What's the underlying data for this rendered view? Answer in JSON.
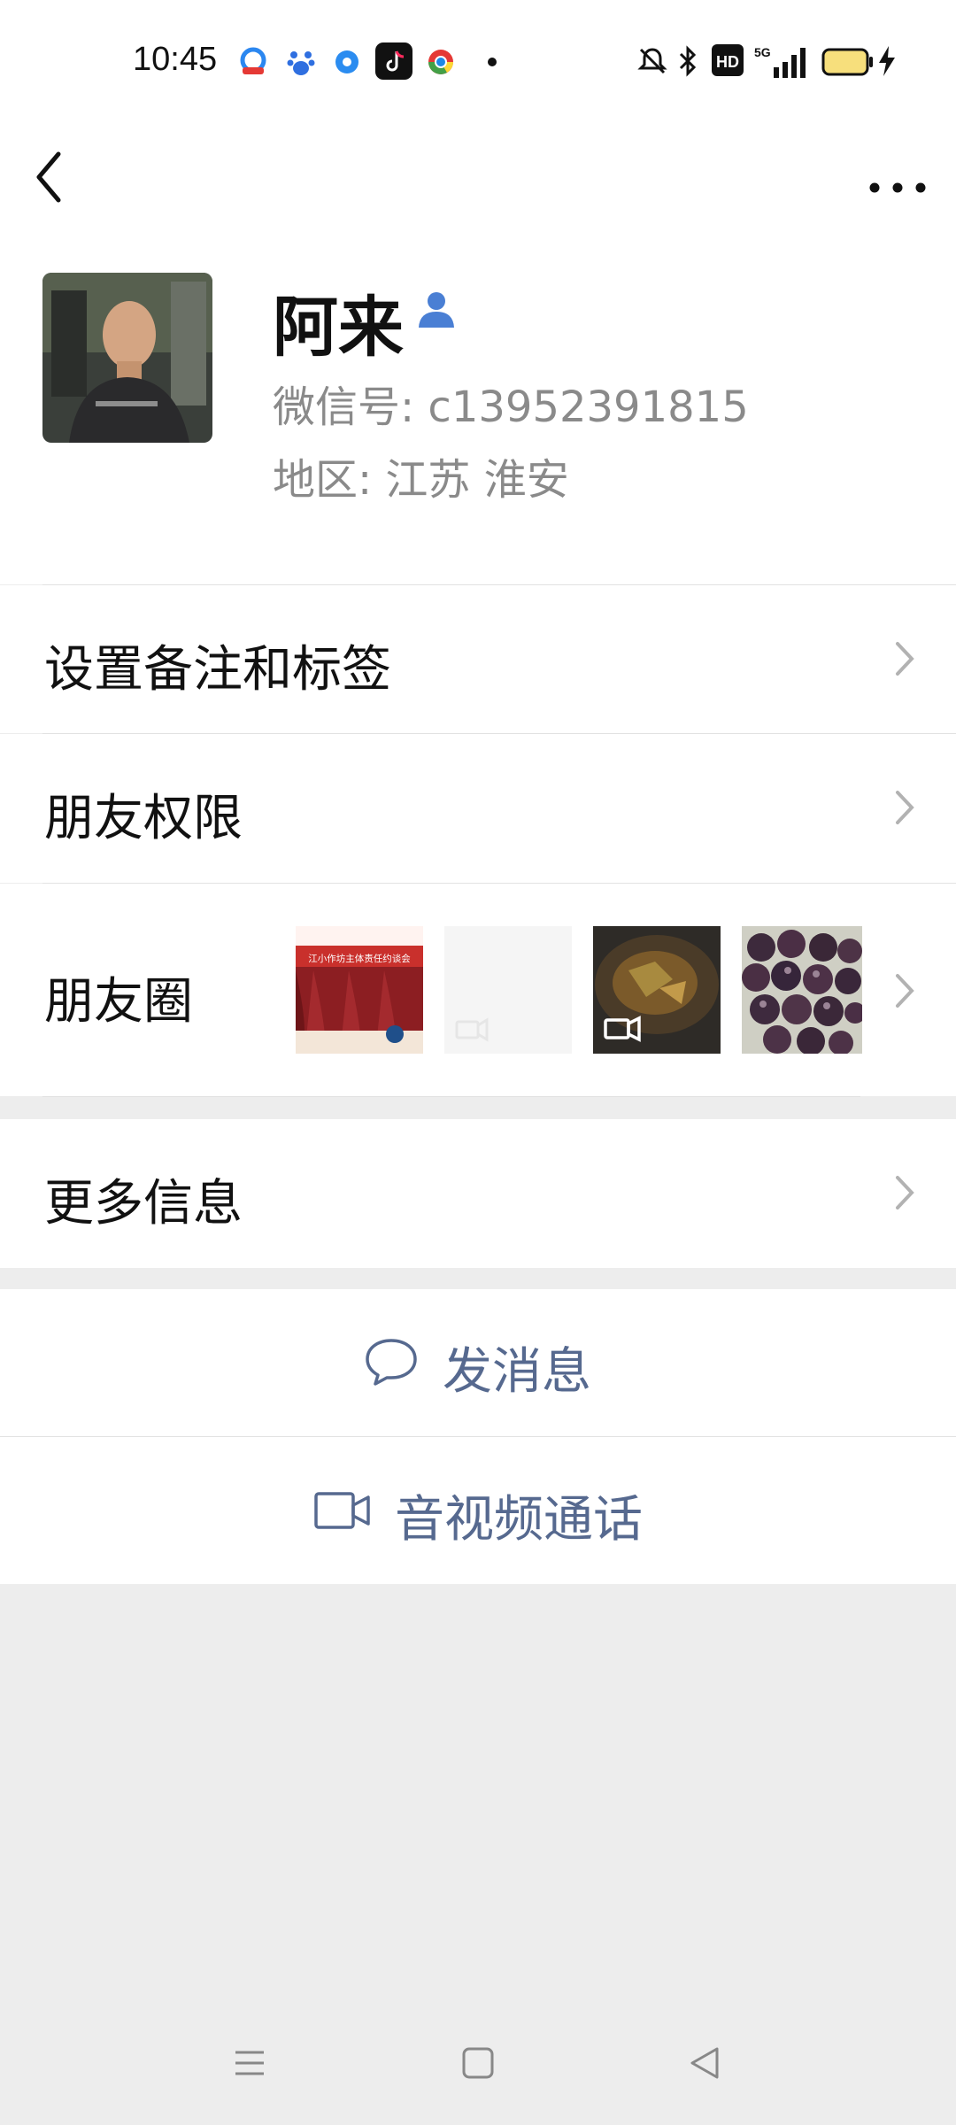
{
  "status_bar": {
    "time": "10:45",
    "app_icons": [
      "qq-browser-icon",
      "baidu-icon",
      "blue-dot-icon",
      "tiktok-icon",
      "chrome-icon",
      "dot-icon"
    ],
    "right_icons": [
      "mute-icon",
      "bluetooth-icon",
      "hd-icon",
      "signal-5g-icon",
      "battery-icon",
      "charging-icon"
    ],
    "network": "5G",
    "hd": "HD"
  },
  "profile": {
    "name": "阿来",
    "wechat_id": "微信号:  c13952391815",
    "region": "地区:  江苏  淮安"
  },
  "rows": {
    "remarks": "设置备注和标签",
    "permissions": "朋友权限",
    "moments": "朋友圈",
    "moments_thumb1_text": "江小作坊主体责任约谈会",
    "more_info": "更多信息"
  },
  "actions": {
    "message": "发消息",
    "call": "音视频通话"
  },
  "colors": {
    "link": "#56698f",
    "background": "#ededed",
    "accent_person": "#4a7fd4"
  }
}
